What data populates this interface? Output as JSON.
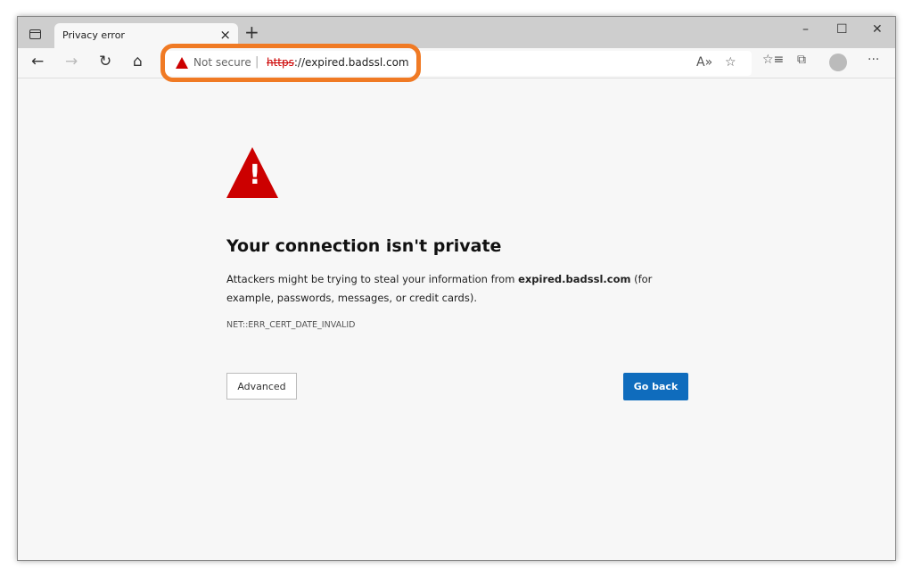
{
  "tab": {
    "title": "Privacy error",
    "close": "×",
    "new_tab": "+"
  },
  "window": {
    "minimize": "–",
    "maximize": "☐",
    "close": "✕"
  },
  "toolbar": {
    "back": "←",
    "forward": "→",
    "refresh": "↻",
    "home": "⌂",
    "read_aloud": "A»",
    "add_favorite": "☆",
    "favorites": "☆≡",
    "collections": "⧉",
    "more": "···"
  },
  "address": {
    "security_label": "Not secure",
    "separator": "|",
    "scheme": "https",
    "rest": "://expired.badssl.com"
  },
  "error": {
    "title": "Your connection isn't private",
    "desc_before": "Attackers might be trying to steal your information from ",
    "domain": "expired.badssl.com",
    "desc_after": " (for example, passwords, messages, or credit cards).",
    "code": "NET::ERR_CERT_DATE_INVALID",
    "icon_mark": "!"
  },
  "buttons": {
    "advanced": "Advanced",
    "go_back": "Go back"
  },
  "colors": {
    "highlight": "#f07a24",
    "danger": "#cc0000",
    "primary": "#0f6cbd"
  }
}
